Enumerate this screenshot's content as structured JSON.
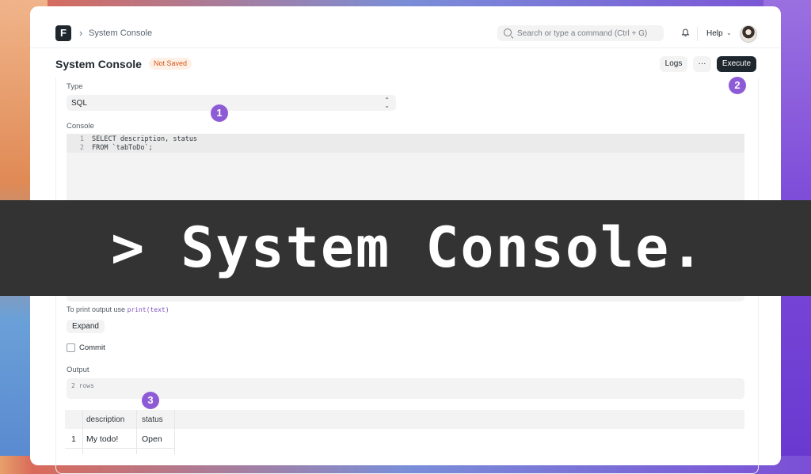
{
  "navbar": {
    "logo": "F",
    "breadcrumb": "System Console",
    "search_placeholder": "Search or type a command (Ctrl + G)",
    "help_label": "Help"
  },
  "header": {
    "title": "System Console",
    "status_badge": "Not Saved",
    "logs_label": "Logs",
    "more_label": "···",
    "execute_label": "Execute"
  },
  "form": {
    "type_label": "Type",
    "type_value": "SQL",
    "console_label": "Console",
    "code_lines": [
      {
        "n": "1",
        "text": "SELECT description, status"
      },
      {
        "n": "2",
        "text": "FROM `tabToDo`;"
      }
    ],
    "hint_prefix": "To print output use",
    "hint_code": "print(text)",
    "expand_label": "Expand",
    "commit_label": "Commit",
    "output_label": "Output",
    "output_text": "2 rows"
  },
  "results": {
    "columns": [
      "description",
      "status"
    ],
    "rows": [
      {
        "index": "1",
        "description": "My todo!",
        "status": "Open"
      }
    ]
  },
  "markers": [
    "1",
    "2",
    "3"
  ],
  "banner": {
    "text": "> System Console."
  },
  "colors": {
    "accent": "#8e5bd6",
    "primary_button": "#1f272e",
    "badge_text": "#d0581c",
    "banner_bg": "#333333"
  }
}
